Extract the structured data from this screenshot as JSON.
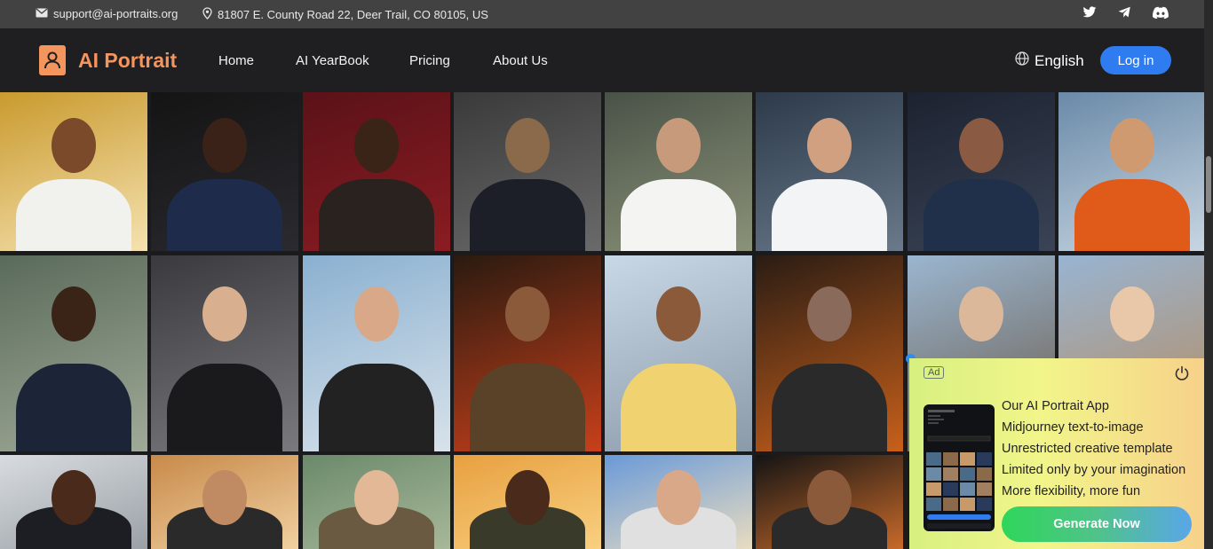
{
  "topbar": {
    "email": "support@ai-portraits.org",
    "address": "81807 E. County Road 22, Deer Trail, CO 80105, US",
    "social_icons": [
      "twitter-icon",
      "telegram-icon",
      "discord-icon"
    ]
  },
  "nav": {
    "logo_text": "AI Portrait",
    "items": [
      {
        "label": "Home"
      },
      {
        "label": "AI YearBook"
      },
      {
        "label": "Pricing"
      },
      {
        "label": "About Us"
      }
    ],
    "language": "English",
    "login_label": "Log in"
  },
  "colors": {
    "accent_orange": "#f4955e",
    "login_blue": "#2f7cf0",
    "topbar_bg": "#424242",
    "nav_bg": "#1f1f21"
  },
  "gallery": {
    "tiles": [
      {
        "subject": "man in white robe with candles"
      },
      {
        "subject": "man in navy suit"
      },
      {
        "subject": "woman with revolver in brocade jacket"
      },
      {
        "subject": "woman in pilot uniform"
      },
      {
        "subject": "female doctor in white coat"
      },
      {
        "subject": "male scientist in lab coat"
      },
      {
        "subject": "businesswoman in blue blazer"
      },
      {
        "subject": "woman racer with motorcycle"
      },
      {
        "subject": "man in suit on city street"
      },
      {
        "subject": "woman in black suit in crowd"
      },
      {
        "subject": "young man selfie at monument"
      },
      {
        "subject": "firefighter"
      },
      {
        "subject": "smiling man selfie on mountain"
      },
      {
        "subject": "DJ with headphones"
      },
      {
        "subject": "woman at temple"
      },
      {
        "subject": "woman at palace"
      },
      {
        "subject": "man in suit by window"
      },
      {
        "subject": "woman in blazer"
      },
      {
        "subject": "smiling woman on great wall"
      },
      {
        "subject": "soldier at sunset"
      },
      {
        "subject": "grey-haired man with sunglasses"
      },
      {
        "subject": "man with glasses in studio"
      }
    ]
  },
  "ad": {
    "tag": "Ad",
    "lines": [
      "Our AI Portrait App",
      "Midjourney text-to-image",
      "Unrestricted creative template",
      "Limited only by your imagination",
      "More flexibility, more fun"
    ],
    "button_label": "Generate Now"
  }
}
